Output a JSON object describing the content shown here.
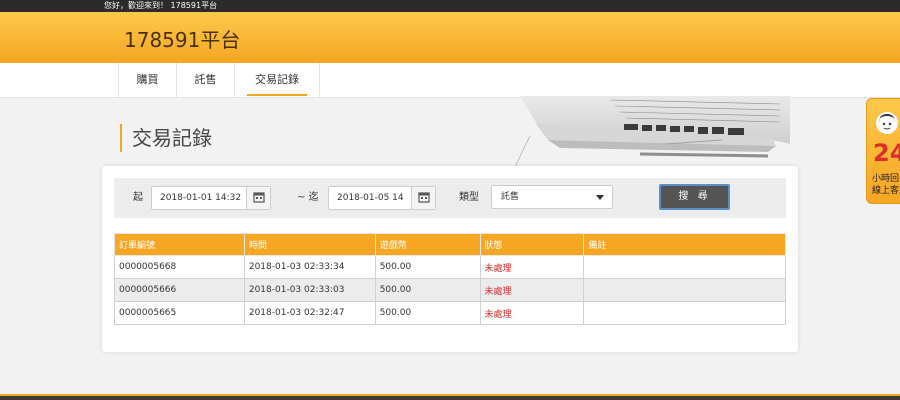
{
  "topbar": {
    "greeting": "您好，歡迎來到！ 178591平台"
  },
  "header": {
    "brand": "178591平台"
  },
  "nav": {
    "tabs": [
      {
        "label": "購買"
      },
      {
        "label": "託售"
      },
      {
        "label": "交易記錄",
        "active": true
      }
    ]
  },
  "page": {
    "title": "交易記錄"
  },
  "filter": {
    "start_label": "起",
    "start_value": "2018-01-01 14:32",
    "end_label": "~ 迄",
    "end_value": "2018-01-05 14",
    "type_label": "類型",
    "type_value": "託售",
    "search_label": "搜 尋"
  },
  "table": {
    "headers": [
      "訂單編號",
      "時間",
      "遊戲幣",
      "狀態",
      "備註"
    ],
    "rows": [
      {
        "order": "0000005668",
        "time": "2018-01-03 02:33:34",
        "coins": "500.00",
        "status": "未處理",
        "note": ""
      },
      {
        "order": "0000005666",
        "time": "2018-01-03 02:33:03",
        "coins": "500.00",
        "status": "未處理",
        "note": ""
      },
      {
        "order": "0000005665",
        "time": "2018-01-03 02:32:47",
        "coins": "500.00",
        "status": "未處理",
        "note": ""
      }
    ]
  },
  "side_widget": {
    "number": "24",
    "line1": "小時回",
    "line2": "線上客"
  },
  "colors": {
    "accent": "#f6a623",
    "status_pending": "#e02b2b",
    "topbar": "#2b2b2b"
  },
  "icons": {
    "calendar": "calendar-icon",
    "dropdown": "chevron-down-icon",
    "support": "customer-service-icon"
  }
}
